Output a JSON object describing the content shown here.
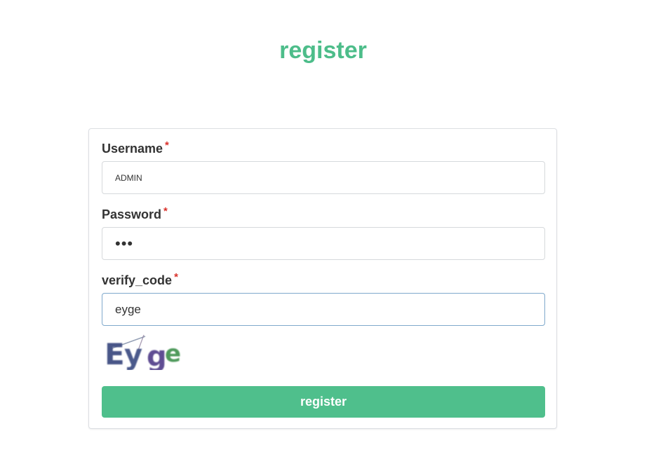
{
  "page": {
    "title": "register"
  },
  "form": {
    "username": {
      "label": "Username",
      "required_mark": "*",
      "value": "ADMIN"
    },
    "password": {
      "label": "Password",
      "required_mark": "*",
      "value": "•••"
    },
    "verify_code": {
      "label": "verify_code",
      "required_mark": "*",
      "value": "eyge"
    },
    "captcha": {
      "text": "Eyge"
    },
    "submit_label": "register"
  },
  "colors": {
    "accent": "#4fbf8c",
    "title": "#4dbd8a",
    "required": "#d9312b",
    "focus_border": "#7fa9cc"
  }
}
